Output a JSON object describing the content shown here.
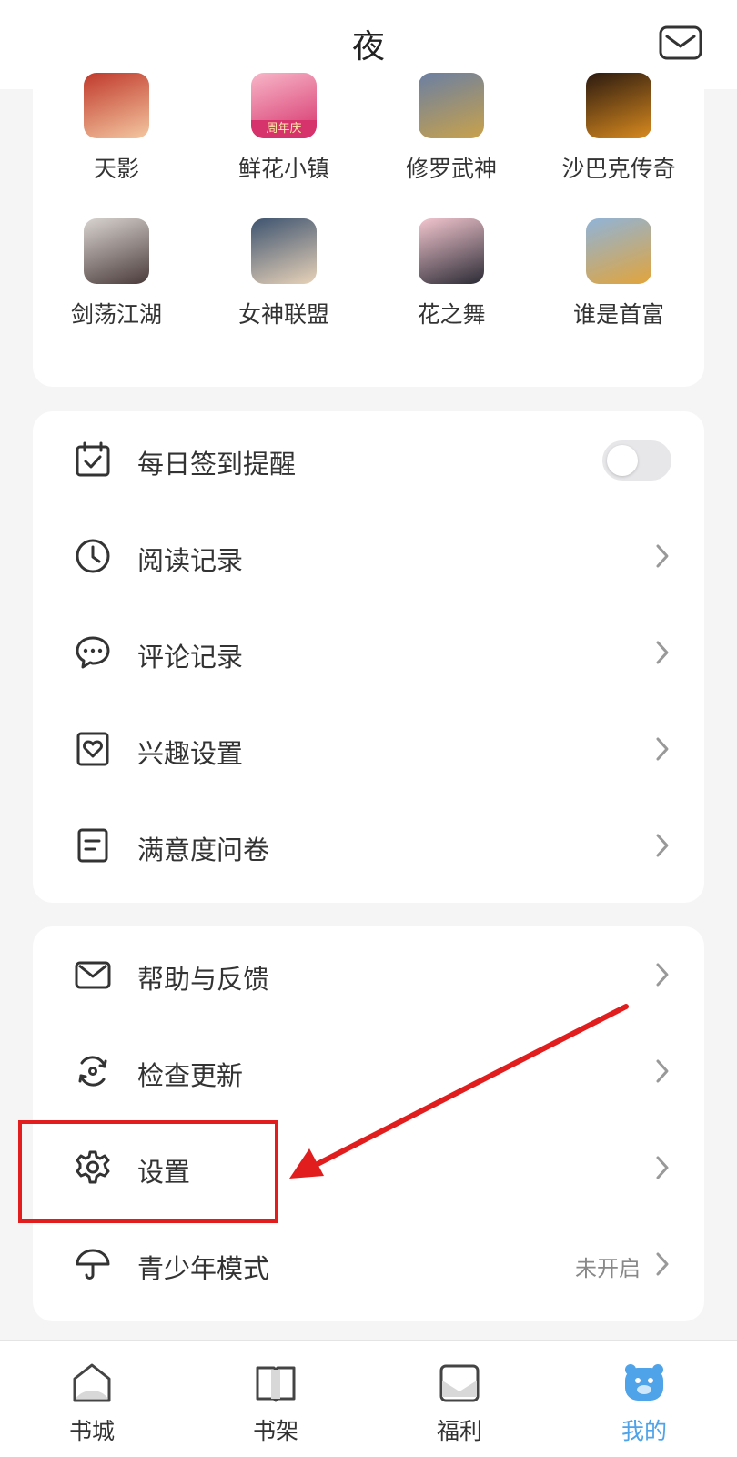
{
  "header": {
    "title": "夜"
  },
  "games": [
    {
      "label": "天影",
      "icon": "game-tianying-icon",
      "colors": [
        "#c0392b",
        "#f4c7a1"
      ]
    },
    {
      "label": "鲜花小镇",
      "icon": "game-xianhua-icon",
      "colors": [
        "#f7b6c8",
        "#d6336c"
      ],
      "badge": "周年庆"
    },
    {
      "label": "修罗武神",
      "icon": "game-xiuluo-icon",
      "colors": [
        "#6a7fa3",
        "#c9a24a"
      ]
    },
    {
      "label": "沙巴克传奇",
      "icon": "game-shabake-icon",
      "colors": [
        "#2b1a10",
        "#d98a1e"
      ]
    },
    {
      "label": "剑荡江湖",
      "icon": "game-jiandang-icon",
      "colors": [
        "#d9d4d0",
        "#4a3b3a"
      ]
    },
    {
      "label": "女神联盟",
      "icon": "game-nvshen-icon",
      "colors": [
        "#3e5470",
        "#e8d2b8"
      ]
    },
    {
      "label": "花之舞",
      "icon": "game-huazhiwu-icon",
      "colors": [
        "#f3c6cf",
        "#2b2b35"
      ]
    },
    {
      "label": "谁是首富",
      "icon": "game-shouful-icon",
      "colors": [
        "#8fb4d9",
        "#e2a43a"
      ]
    }
  ],
  "menu1": [
    {
      "label": "每日签到提醒",
      "icon": "calendar-check-icon",
      "type": "toggle",
      "on": false
    },
    {
      "label": "阅读记录",
      "icon": "clock-icon",
      "type": "link"
    },
    {
      "label": "评论记录",
      "icon": "chat-bubble-icon",
      "type": "link"
    },
    {
      "label": "兴趣设置",
      "icon": "heart-box-icon",
      "type": "link"
    },
    {
      "label": "满意度问卷",
      "icon": "document-icon",
      "type": "link"
    }
  ],
  "menu2": [
    {
      "label": "帮助与反馈",
      "icon": "mail-icon",
      "type": "link"
    },
    {
      "label": "检查更新",
      "icon": "refresh-icon",
      "type": "link"
    },
    {
      "label": "设置",
      "icon": "gear-icon",
      "type": "link"
    },
    {
      "label": "青少年模式",
      "icon": "umbrella-icon",
      "type": "link",
      "value": "未开启"
    }
  ],
  "tabs": [
    {
      "label": "书城",
      "icon": "home-icon",
      "active": false
    },
    {
      "label": "书架",
      "icon": "book-icon",
      "active": false
    },
    {
      "label": "福利",
      "icon": "gift-icon",
      "active": false
    },
    {
      "label": "我的",
      "icon": "bear-icon",
      "active": true
    }
  ],
  "colors": {
    "accent": "#4fa3e8",
    "annotation": "#e21d1d",
    "text": "#333333",
    "muted": "#888888"
  }
}
